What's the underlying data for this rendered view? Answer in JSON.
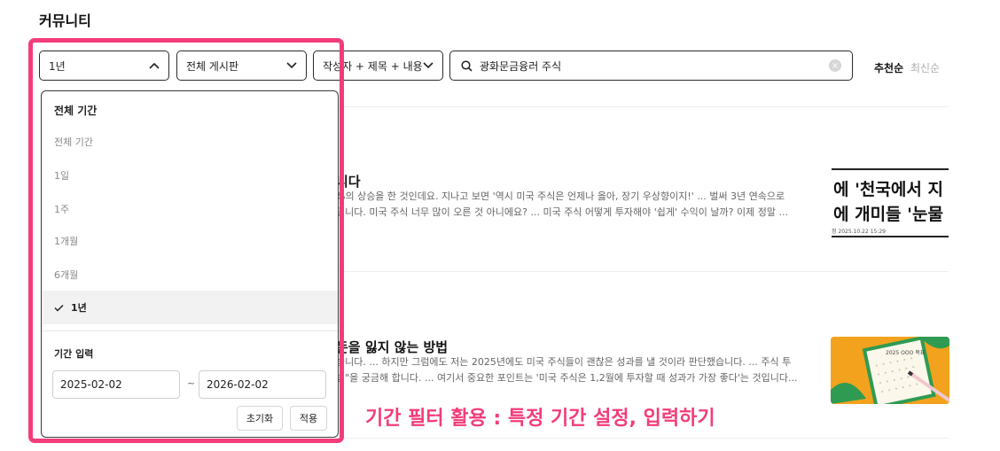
{
  "page": {
    "title": "커뮤니티"
  },
  "filters": {
    "period": "1년",
    "board": "전체 게시판",
    "scope": "작성자 + 제목 + 내용"
  },
  "search": {
    "value": "광화문금융러 주식"
  },
  "sort": {
    "recommended": "추천순",
    "latest": "최신순"
  },
  "dropdown": {
    "header": "전체 기간",
    "options": [
      "전체 기간",
      "1일",
      "1주",
      "1개월",
      "6개월",
      "1년"
    ],
    "selected_index": 5,
    "range_label": "기간 입력",
    "start_date": "2025-02-02",
    "end_date": "2026-02-02",
    "tilde": "~",
    "reset_label": "초기화",
    "apply_label": "적용"
  },
  "articles": [
    {
      "title": "니다",
      "snippet1": "%의 상승을 한 것인데요. 지나고 보면 '역시 미국 주식은 언제나 옳아, 장기 우상향이지!' ... 벌써 3년 연속으로",
      "snippet2": "입니다. 미국 주식 너무 많이 오른 것 아니에요? ... 미국 주식 어떻게 투자해야 '쉽게' 수익이 날까? 이제 정말 ...",
      "thumb_line1": "에 '천국에서 지",
      "thumb_line2": "에 개미들 '눈물",
      "thumb_date": "정 2025.10.22 15:29"
    },
    {
      "title": "돈을 잃지 않는 방법",
      "snippet1": "습니다. ... 하지만 그럼에도 저는 2025년에도 미국 주식들이 괜찮은 성과를 낼 것이라 판단했습니다. ... 주식 투",
      "snippet2": "법\"을 궁금해 합니다. ... 여기서 중요한 포인트는 '미국 주식은 1,2월에 투자할 때 성과가 가장 좋다'는 것입니다...",
      "thumb_text": "2025 OOO 목표"
    }
  ],
  "annotation": {
    "caption": "기간 필터 활용 : 특정 기간 설정, 입력하기"
  },
  "colors": {
    "highlight": "#f23d78",
    "text": "#222222",
    "muted": "#888888"
  },
  "icons": {
    "chevron_up": "chevron-up-icon",
    "chevron_down": "chevron-down-icon",
    "search": "search-icon",
    "clear": "clear-icon",
    "check": "check-icon"
  }
}
